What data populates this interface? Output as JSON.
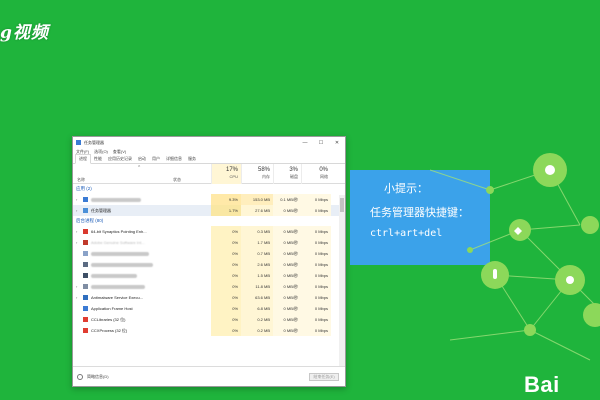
{
  "watermark": "g视频",
  "window": {
    "title": "任务管理器",
    "controls": [
      "—",
      "☐",
      "✕"
    ],
    "menu": [
      "文件(F)",
      "选项(O)",
      "查看(V)"
    ],
    "tabs": [
      "进程",
      "性能",
      "应用历史记录",
      "启动",
      "用户",
      "详细信息",
      "服务"
    ],
    "header": {
      "name": "名称",
      "status": "状态",
      "cpu": {
        "pct": "17%",
        "label": "CPU"
      },
      "memory": {
        "pct": "58%",
        "label": "内存"
      },
      "disk": {
        "pct": "3%",
        "label": "磁盘"
      },
      "network": {
        "pct": "0%",
        "label": "网络"
      }
    },
    "apps_section": "应用 (2)",
    "bg_section": "后台进程 (80)",
    "app_rows": [
      {
        "name": "",
        "cpu": "9.3%",
        "mem": "153.0 MB",
        "disk": "0.1 MB/秒",
        "net": "0 Mbps"
      },
      {
        "name": "任务管理器",
        "cpu": "1.7%",
        "mem": "27.6 MB",
        "disk": "0 MB/秒",
        "net": "0 Mbps"
      }
    ],
    "bg_rows": [
      {
        "name": "64-bit Synaptics Pointing Enh...",
        "cpu": "0%",
        "mem": "0.3 MB",
        "disk": "0 MB/秒",
        "net": "0 Mbps"
      },
      {
        "name": "Adobe Genuine Software Int...",
        "cpu": "0%",
        "mem": "1.7 MB",
        "disk": "0 MB/秒",
        "net": "0 Mbps"
      },
      {
        "name": "",
        "cpu": "0%",
        "mem": "0.7 MB",
        "disk": "0 MB/秒",
        "net": "0 Mbps"
      },
      {
        "name": "",
        "cpu": "0%",
        "mem": "2.6 MB",
        "disk": "0 MB/秒",
        "net": "0 Mbps"
      },
      {
        "name": "",
        "cpu": "0%",
        "mem": "1.5 MB",
        "disk": "0 MB/秒",
        "net": "0 Mbps"
      },
      {
        "name": "",
        "cpu": "0%",
        "mem": "11.8 MB",
        "disk": "0 MB/秒",
        "net": "0 Mbps"
      },
      {
        "name": "Antimalware Service Execu...",
        "cpu": "0%",
        "mem": "63.6 MB",
        "disk": "0 MB/秒",
        "net": "0 Mbps"
      },
      {
        "name": "Application Frame Host",
        "cpu": "0%",
        "mem": "6.8 MB",
        "disk": "0 MB/秒",
        "net": "0 Mbps"
      },
      {
        "name": "CCLibraries (32 位)",
        "cpu": "0%",
        "mem": "0.2 MB",
        "disk": "0 MB/秒",
        "net": "0 Mbps"
      },
      {
        "name": "CCXProcess (32 位)",
        "cpu": "0%",
        "mem": "0.2 MB",
        "disk": "0 MB/秒",
        "net": "0 Mbps"
      }
    ],
    "footer_text": "简略信息(D)",
    "end_task": "结束任务(E)"
  },
  "tip": {
    "title": "小提示：",
    "line": "任务管理器快捷键：",
    "keys": "ctrl+art+del"
  },
  "logo": "Bai"
}
